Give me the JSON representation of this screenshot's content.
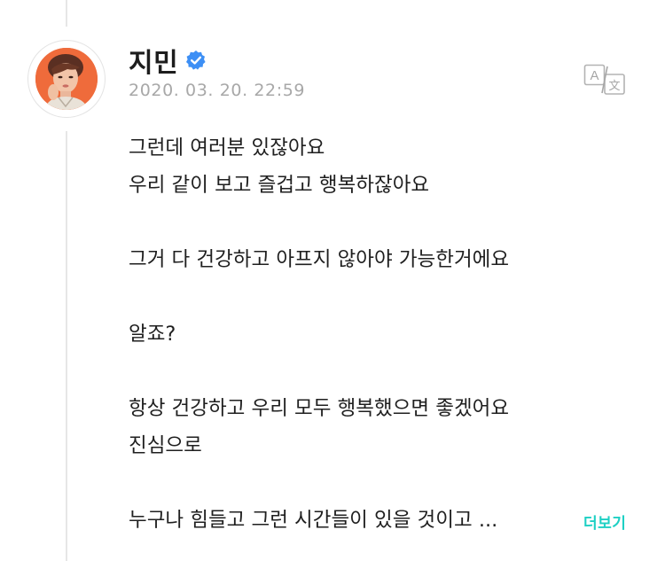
{
  "post": {
    "author": "지민",
    "timestamp": "2020. 03. 20. 22:59",
    "lines": [
      "그런데 여러분 있잖아요",
      "우리 같이 보고 즐겁고 행복하잖아요",
      "",
      "그거 다 건강하고 아프지 않아야 가능한거에요",
      "",
      "알죠?",
      "",
      "항상 건강하고 우리 모두 행복했으면 좋겠어요",
      "진심으로",
      "",
      "누구나 힘들고 그런 시간들이 있을 것이고 ..."
    ],
    "more_label": "더보기"
  },
  "icons": {
    "verified": "verified-badge-icon",
    "translate": "translate-icon"
  },
  "colors": {
    "accent": "#1ed0c4",
    "verified_blue": "#3d8ff5",
    "avatar_bg": "#ef6b3b",
    "meta_gray": "#a8a8a8"
  }
}
